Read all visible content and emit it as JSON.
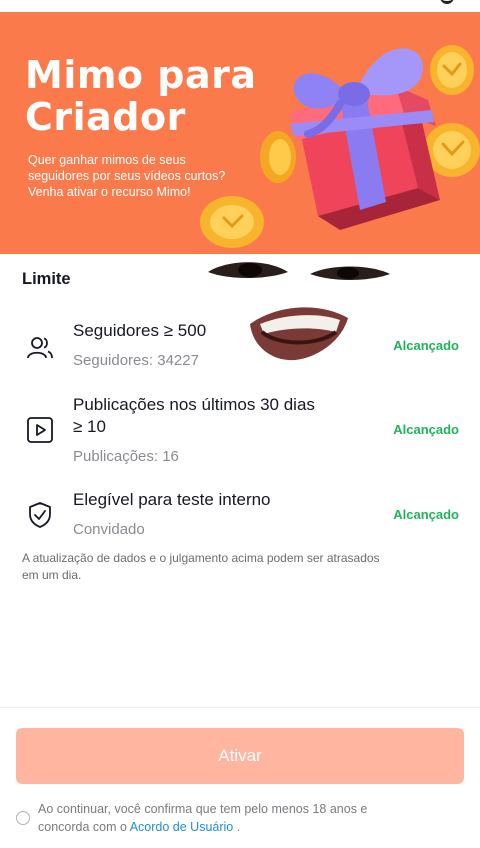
{
  "banner": {
    "title_line1": "Mimo para",
    "title_line2": "Criador",
    "subtitle_line1": "Quer ganhar mimos de seus",
    "subtitle_line2": "seguidores por seus vídeos curtos?",
    "subtitle_line3": "Venha ativar o recurso Mimo!",
    "background_color": "#fb7a4c"
  },
  "section": {
    "title": "Limite"
  },
  "requirements": [
    {
      "icon": "followers-icon",
      "name": "Seguidores ≥ 500",
      "value": "Seguidores: 34227",
      "status": "Alcançado"
    },
    {
      "icon": "video-play-icon",
      "name_line1": "Publicações nos últimos 30 dias",
      "name_line2": "≥ 10",
      "value": "Publicações: 16",
      "status": "Alcançado"
    },
    {
      "icon": "shield-check-icon",
      "name": "Elegível para teste interno",
      "value": "Convidado",
      "status": "Alcançado"
    }
  ],
  "note": {
    "line1": "A atualização de dados e o julgamento acima podem ser atrasados",
    "line2": "em um dia."
  },
  "action": {
    "activate_label": "Ativar",
    "color": "#ffb5a0"
  },
  "consent": {
    "line1": "Ao continuar, você confirma que tem pelo menos 18 anos e",
    "line2_prefix": "concorda com o ",
    "link": "Acordo de Usuário",
    "line2_suffix": " ."
  },
  "colors": {
    "status_green": "#20b35a",
    "link_blue": "#1f8fd6"
  }
}
